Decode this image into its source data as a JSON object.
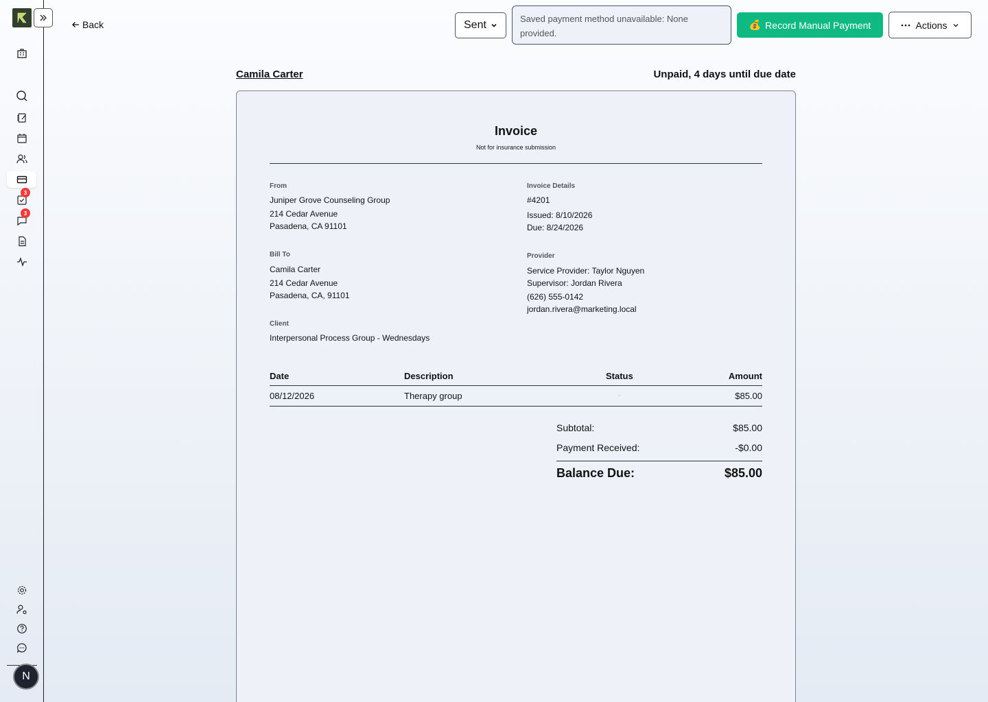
{
  "sidebar": {
    "badges": {
      "tasks": "3",
      "messages": "3"
    },
    "avatar_initial": "N"
  },
  "topbar": {
    "back_label": "Back",
    "status_value": "Sent",
    "notice": "Saved payment method unavailable: None provided.",
    "record_payment_label": "Record Manual Payment",
    "actions_label": "Actions"
  },
  "header": {
    "client_name": "Camila Carter",
    "due_status": "Unpaid, 4 days until due date"
  },
  "invoice": {
    "title": "Invoice",
    "subtitle": "Not for insurance submission",
    "from": {
      "label": "From",
      "name": "Juniper Grove Counseling Group",
      "address1": "214 Cedar Avenue",
      "address2": "Pasadena, CA 91101"
    },
    "details": {
      "label": "Invoice Details",
      "number": "#4201",
      "issued": "Issued: 8/10/2026",
      "due": "Due: 8/24/2026"
    },
    "bill_to": {
      "label": "Bill To",
      "name": "Camila Carter",
      "address1": "214 Cedar Avenue",
      "address2": "Pasadena, CA, 91101"
    },
    "provider": {
      "label": "Provider",
      "service_provider": "Service Provider: Taylor Nguyen",
      "supervisor": "Supervisor: Jordan Rivera",
      "phone": "(626) 555-0142",
      "email": "jordan.rivera@marketing.local"
    },
    "client": {
      "label": "Client",
      "value": "Interpersonal Process Group - Wednesdays"
    },
    "table": {
      "headers": {
        "date": "Date",
        "description": "Description",
        "status": "Status",
        "amount": "Amount"
      },
      "rows": [
        {
          "date": "08/12/2026",
          "description": "Therapy group",
          "status": "-",
          "amount": "$85.00"
        }
      ]
    },
    "summary": {
      "subtotal_label": "Subtotal:",
      "subtotal": "$85.00",
      "received_label": "Payment Received:",
      "received": "-$0.00",
      "balance_label": "Balance Due:",
      "balance": "$85.00"
    }
  },
  "colors": {
    "accent_green": "#10b981",
    "badge_red": "#ef3b3b"
  }
}
